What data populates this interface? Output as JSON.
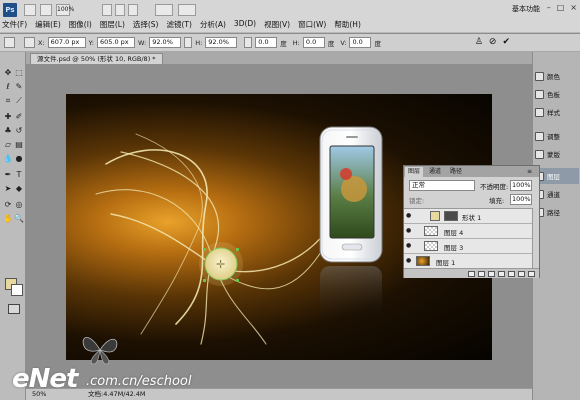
{
  "app": {
    "logo": "Ps",
    "workspace": "基本功能"
  },
  "menu": [
    "文件(F)",
    "编辑(E)",
    "图像(I)",
    "图层(L)",
    "选择(S)",
    "滤镜(T)",
    "分析(A)",
    "3D(D)",
    "视图(V)",
    "窗口(W)",
    "帮助(H)"
  ],
  "menubar_zoom": "100%",
  "options": {
    "x_label": "X:",
    "x_value": "607.0 px",
    "y_label": "Y:",
    "y_value": "605.0 px",
    "w_label": "W:",
    "w_value": "92.0%",
    "h_label": "H:",
    "h_value": "92.0%",
    "angle_value": "0.0",
    "hskew_label": "H:",
    "hskew_value": "0.0",
    "vskew_label": "V:",
    "vskew_value": "0.0",
    "units": "度"
  },
  "document_tab": "源文件.psd @ 50% (形状 10, RGB/8) *",
  "status": {
    "zoom": "50%",
    "doc_size": "文档:4.47M/42.4M"
  },
  "dock": [
    {
      "label": "颜色",
      "icon": "color-icon"
    },
    {
      "label": "色板",
      "icon": "swatches-icon"
    },
    {
      "label": "样式",
      "icon": "styles-icon"
    },
    {
      "label": "调整",
      "icon": "adjustments-icon"
    },
    {
      "label": "蒙版",
      "icon": "masks-icon"
    },
    {
      "label": "图层",
      "icon": "layers-icon"
    },
    {
      "label": "通道",
      "icon": "channels-icon"
    },
    {
      "label": "路径",
      "icon": "paths-icon"
    }
  ],
  "layers_panel": {
    "tabs": [
      "图层",
      "通道",
      "路径"
    ],
    "blend_mode": "正常",
    "opacity_label": "不透明度:",
    "opacity_value": "100%",
    "lock_label": "锁定:",
    "fill_label": "填充:",
    "fill_value": "100%",
    "layers": [
      {
        "name": "形状 1",
        "visible": true
      },
      {
        "name": "图层 4",
        "visible": true
      },
      {
        "name": "图层 3",
        "visible": true
      },
      {
        "name": "图层 1",
        "visible": true
      }
    ]
  },
  "watermark": {
    "brand": "eNet",
    "url": ".com.cn/eschool"
  },
  "colors": {
    "foreground": "#e7d8a0",
    "background": "#ffffff",
    "glow": "#e9a22a"
  }
}
